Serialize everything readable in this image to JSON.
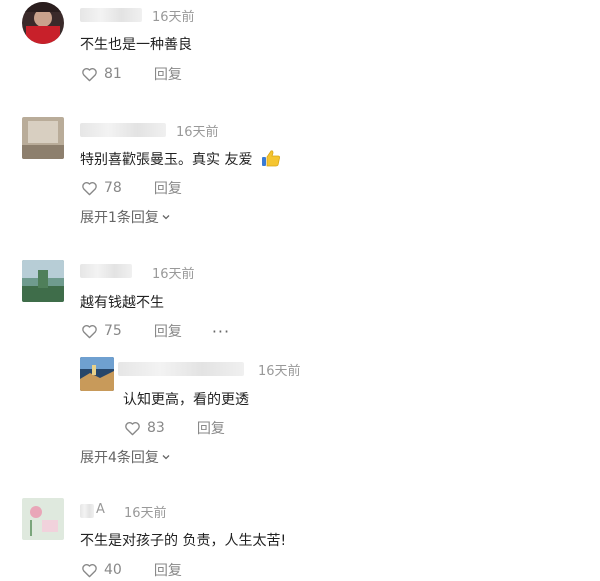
{
  "comments": [
    {
      "time": "16天前",
      "text": "不生也是一种善良",
      "likes": "81",
      "reply_label": "回复"
    },
    {
      "time": "16天前",
      "text": "特别喜歡張曼玉。真实 友爱",
      "likes": "78",
      "reply_label": "回复",
      "expand_label": "展开1条回复"
    },
    {
      "time": "16天前",
      "text": "越有钱越不生",
      "likes": "75",
      "reply_label": "回复",
      "more_label": "···",
      "replies": [
        {
          "time": "16天前",
          "text": "认知更高，看的更透",
          "likes": "83",
          "reply_label": "回复"
        }
      ],
      "expand_label": "展开4条回复"
    },
    {
      "name_fragment": "A",
      "time": "16天前",
      "text": "不生是对孩子的 负责，人生太苦!",
      "likes": "40",
      "reply_label": "回复"
    }
  ],
  "icons": {
    "like": "heart-outline-icon",
    "expand": "chevron-down-icon",
    "emoji": "thumbs-up-emoji-icon"
  }
}
